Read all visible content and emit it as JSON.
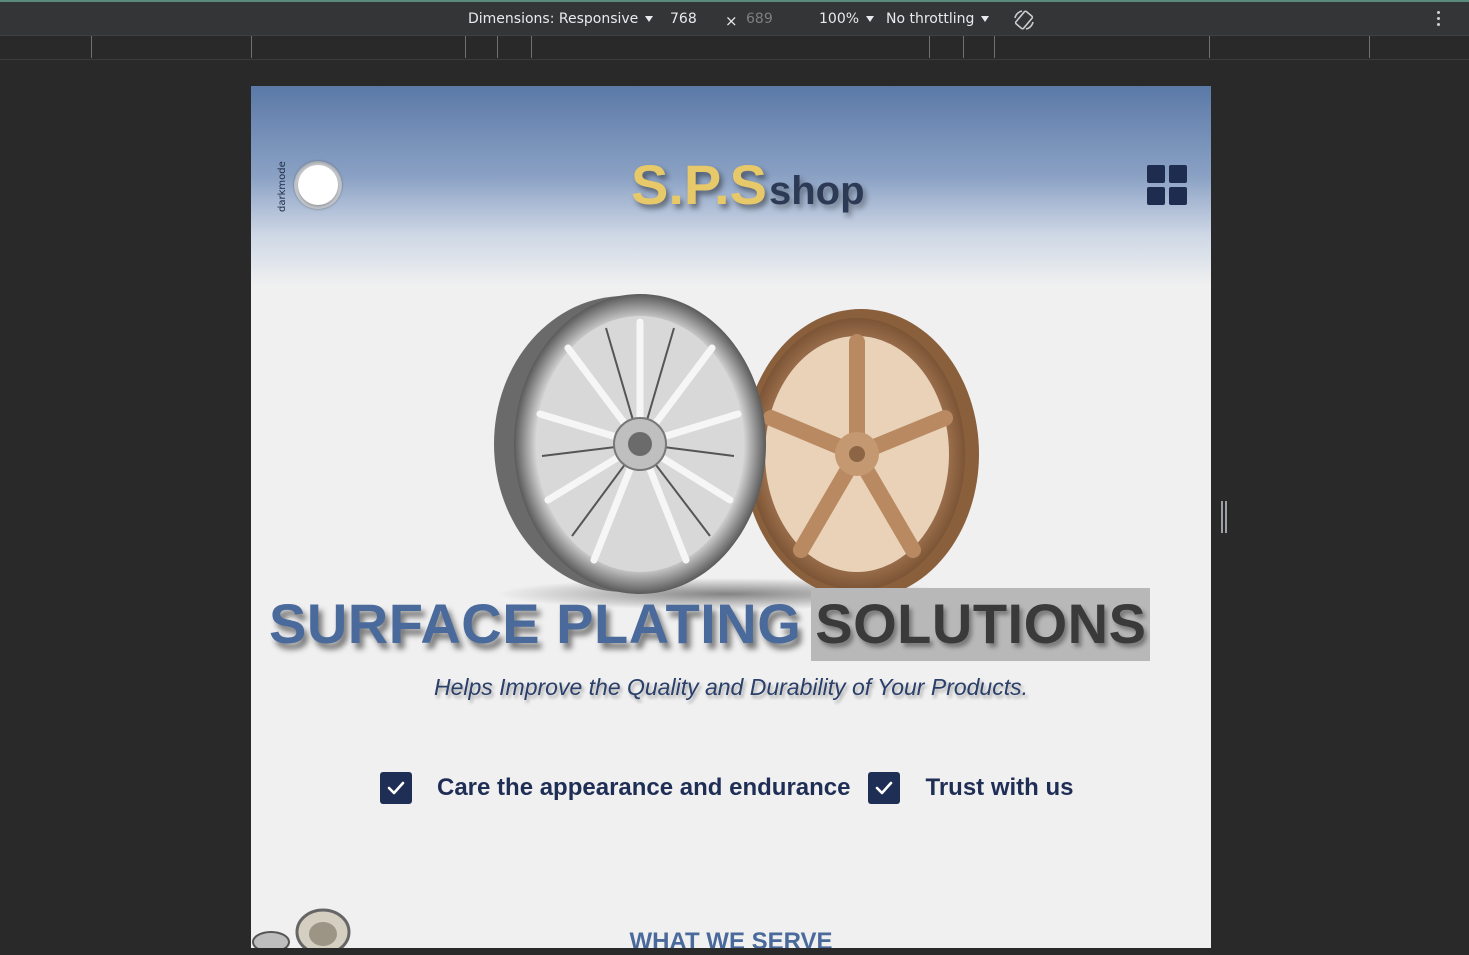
{
  "devtools": {
    "dimensions_label": "Dimensions: Responsive",
    "width_value": "768",
    "times_glyph": "×",
    "height_placeholder": "689",
    "zoom": "100%",
    "throttling": "No throttling",
    "rotate_icon": "rotate-icon",
    "more_icon": "kebab-menu-icon"
  },
  "site": {
    "darkmode_label": "darkmode",
    "logo_brand": "S.P.S",
    "logo_suffix": "shop",
    "menu_icon": "grid-menu-icon",
    "headline_part1": "SURFACE PLATING",
    "headline_part2": "SOLUTIONS",
    "tagline": "Helps Improve the Quality and Durability of Your Products.",
    "features": [
      {
        "label": "Care the appearance and endurance",
        "icon": "checkbox-check-icon"
      },
      {
        "label": "Trust with us",
        "icon": "checkbox-check-icon"
      }
    ],
    "section_title": "WHAT WE SERVE"
  },
  "colors": {
    "navy": "#1f2e55",
    "steel_blue": "#4a6a9c",
    "gold": "#e8c96a",
    "devtools_bg": "#343536"
  }
}
